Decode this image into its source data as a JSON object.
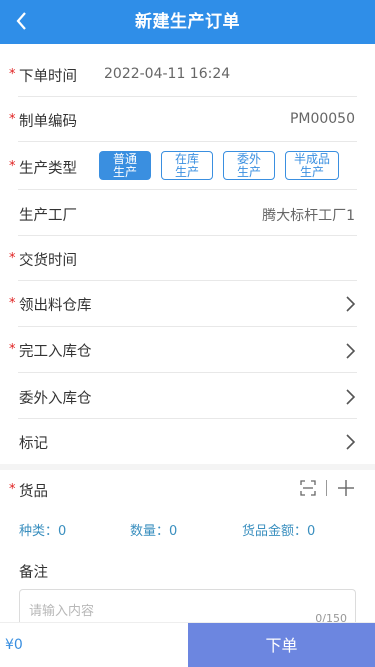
{
  "header": {
    "title": "新建生产订单",
    "back_icon": "chevron-left-icon"
  },
  "form": {
    "order_time": {
      "required": "*",
      "label": "下单时间",
      "value": "2022-04-11 16:24"
    },
    "order_code": {
      "required": "*",
      "label": "制单编码",
      "value": "PM00050"
    },
    "production_type": {
      "required": "*",
      "label": "生产类型",
      "options": [
        {
          "line1": "普通",
          "line2": "生产",
          "selected": true
        },
        {
          "line1": "在库",
          "line2": "生产",
          "selected": false
        },
        {
          "line1": "委外",
          "line2": "生产",
          "selected": false
        },
        {
          "line1": "半成品",
          "line2": "生产",
          "selected": false
        }
      ]
    },
    "factory": {
      "label": "生产工厂",
      "value": "腾大标杆工厂1"
    },
    "delivery_time": {
      "required": "*",
      "label": "交货时间"
    },
    "material_warehouse": {
      "required": "*",
      "label": "领出料仓库"
    },
    "finished_warehouse": {
      "required": "*",
      "label": "完工入库仓"
    },
    "outsource_warehouse": {
      "label": "委外入库仓"
    },
    "tag": {
      "label": "标记"
    }
  },
  "goods": {
    "required": "*",
    "label": "货品",
    "stats": {
      "kinds": "种类：0",
      "quantity": "数量：0",
      "amount": "货品金额：0"
    }
  },
  "remark": {
    "label": "备注",
    "placeholder": "请输入内容",
    "counter": "0/150"
  },
  "footer": {
    "total": "¥0",
    "submit_label": "下单"
  },
  "colors": {
    "primary": "#2f8ee8",
    "chip": "#3a8fe0",
    "submit": "#6c86e0",
    "required": "#e02020"
  }
}
